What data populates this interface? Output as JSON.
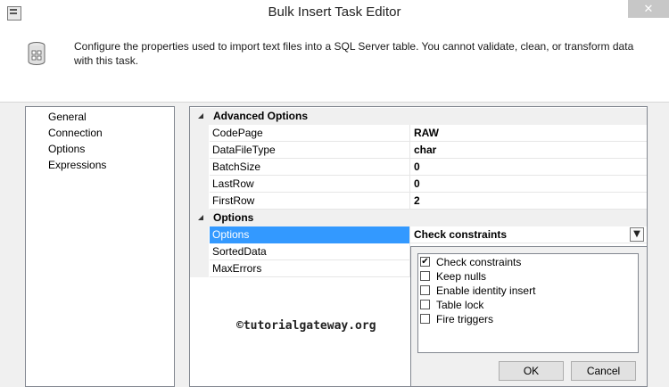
{
  "window": {
    "title": "Bulk Insert Task Editor",
    "close_glyph": "✕"
  },
  "header": {
    "description": "Configure the properties used to import text files into a SQL Server table. You cannot validate, clean, or transform data with this task."
  },
  "nav": {
    "items": [
      {
        "label": "General"
      },
      {
        "label": "Connection"
      },
      {
        "label": "Options"
      },
      {
        "label": "Expressions"
      }
    ],
    "selected": "Options"
  },
  "grid": {
    "categories": [
      {
        "label": "Advanced Options"
      },
      {
        "label": "Options"
      }
    ],
    "advanced": [
      {
        "name": "CodePage",
        "value": "RAW"
      },
      {
        "name": "DataFileType",
        "value": "char"
      },
      {
        "name": "BatchSize",
        "value": "0"
      },
      {
        "name": "LastRow",
        "value": "0"
      },
      {
        "name": "FirstRow",
        "value": "2"
      }
    ],
    "options": [
      {
        "name": "Options",
        "value": "Check constraints",
        "selected": true
      },
      {
        "name": "SortedData",
        "value": ""
      },
      {
        "name": "MaxErrors",
        "value": ""
      }
    ]
  },
  "dropdown": {
    "items": [
      {
        "label": "Check constraints",
        "checked": true
      },
      {
        "label": "Keep nulls",
        "checked": false
      },
      {
        "label": "Enable identity insert",
        "checked": false
      },
      {
        "label": "Table lock",
        "checked": false
      },
      {
        "label": "Fire triggers",
        "checked": false
      }
    ],
    "ok_label": "OK",
    "cancel_label": "Cancel"
  },
  "watermark": {
    "text": "©tutorialgateway.org"
  }
}
